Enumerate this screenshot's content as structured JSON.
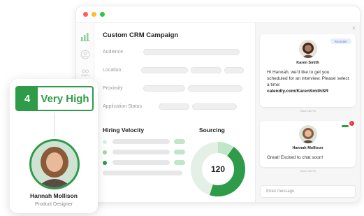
{
  "campaign": {
    "title": "Custom CRM Campaign",
    "fields": [
      "Audience",
      "Location",
      "Proximity",
      "Application Status"
    ]
  },
  "hiring_velocity": {
    "title": "Hiring Velocity"
  },
  "sourcing": {
    "title": "Sourcing",
    "value": "120"
  },
  "chat": {
    "message1": {
      "tag": "Recruiter",
      "sender": "Karen Smith",
      "text": "Hi Hannah, we'd like to get you scheduled for an interview. Please select a time:",
      "link": "calendly.com/KarenSmithSR",
      "timestamp": "Read 3:25 PM"
    },
    "message2": {
      "tag": "",
      "sender": "Hannah Mollison",
      "text": "Great! Excited to chat soon!",
      "timestamp": "Read 3:25 PM"
    },
    "input_placeholder": "Enter message",
    "close_glyph": "×",
    "notification_glyph": "!"
  },
  "profile": {
    "score": "4",
    "score_label": "Very High",
    "name": "Hannah Mollison",
    "role": "Product Designer"
  },
  "colors": {
    "accent_green": "#2e9b48",
    "light_green": "#bfe6c6",
    "recruiter_tag": "#5b7bd8"
  }
}
